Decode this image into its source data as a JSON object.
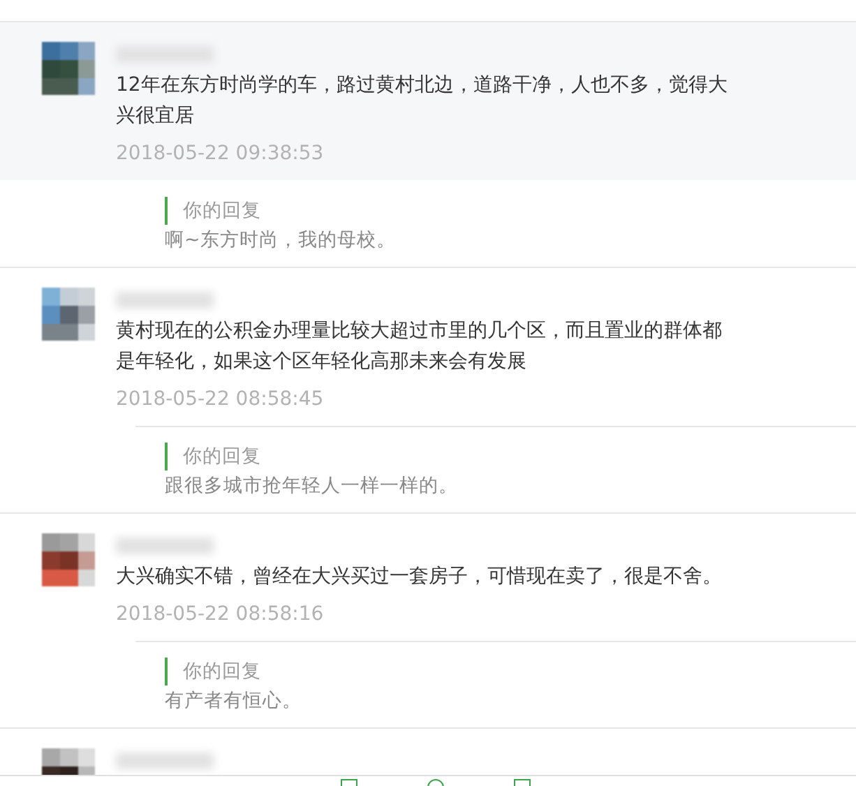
{
  "comments": [
    {
      "highlighted": true,
      "text": "12年在东方时尚学的车，路过黄村北边，道路干净，人也不多，觉得大兴很宜居",
      "time": "2018-05-22 09:38:53",
      "reply": {
        "label": "你的回复",
        "text": "啊~东方时尚，我的母校。"
      }
    },
    {
      "text": "黄村现在的公积金办理量比较大超过市里的几个区，而且置业的群体都是年轻化，如果这个区年轻化高那未来会有发展",
      "time": "2018-05-22 08:58:45",
      "reply": {
        "label": "你的回复",
        "text": "跟很多城市抢年轻人一样一样的。"
      }
    },
    {
      "text": "大兴确实不错，曾经在大兴买过一套房子，可惜现在卖了，很是不舍。",
      "time": "2018-05-22 08:58:16",
      "reply": {
        "label": "你的回复",
        "text": "有产者有恒心。"
      }
    }
  ]
}
